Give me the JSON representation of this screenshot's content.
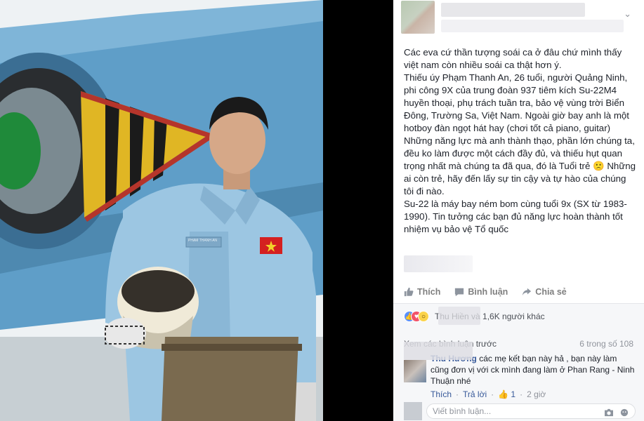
{
  "post": {
    "author_name": "",
    "timestamp": "",
    "text_lines": [
      "Các eva cứ thần tượng soái ca ở đâu chứ mình thấy việt nam còn nhiều soái ca thật hơn ý.",
      "Thiếu úy Phạm Thanh An, 26 tuổi, người Quảng Ninh, phi công 9X của trung đoàn 937 tiêm kích Su-22M4 huyền thoại, phụ trách tuần tra, bảo vệ vùng trời Biển Đông, Trường Sa, Việt Nam. Ngoài giờ bay anh là một hotboy đàn ngọt hát hay (chơi tốt cả piano, guitar)",
      "Những năng lực mà anh thành thạo, phần lớn chúng ta, đều ko làm được một cách đầy đủ, và thiếu hụt quan trọng nhất mà chúng ta đã qua, đó là Tuổi trẻ 🙁 Những ai còn trẻ, hãy đến lấy sự tin cậy và tự hào của chúng tôi đi nào.",
      "Su-22 là máy bay ném bom cùng tuổi 9x (SX từ 1983-1990). Tin tưởng các bạn đủ năng lực hoàn thành tốt nhiệm vụ bảo vệ Tổ quốc"
    ]
  },
  "actions": {
    "like": "Thích",
    "comment": "Bình luận",
    "share": "Chia sẻ"
  },
  "reactions": {
    "summary": "Thu Hiền và 1,6K người khác"
  },
  "comments_section": {
    "view_more": "Xem các bình luận trước",
    "count": "6 trong số 108",
    "comment": {
      "author": "Thu Hương",
      "text": "các mẹ kết bạn này hả , bạn này làm cũng đơn vị với ck mình đang làm ở Phan Rang - Ninh Thuận nhé",
      "like": "Thích",
      "reply": "Trả lời",
      "like_count": "1",
      "time": "2 giờ"
    },
    "write_placeholder": "Viết bình luận..."
  },
  "photo": {
    "name_tag": "PHẠM THANH AN"
  }
}
